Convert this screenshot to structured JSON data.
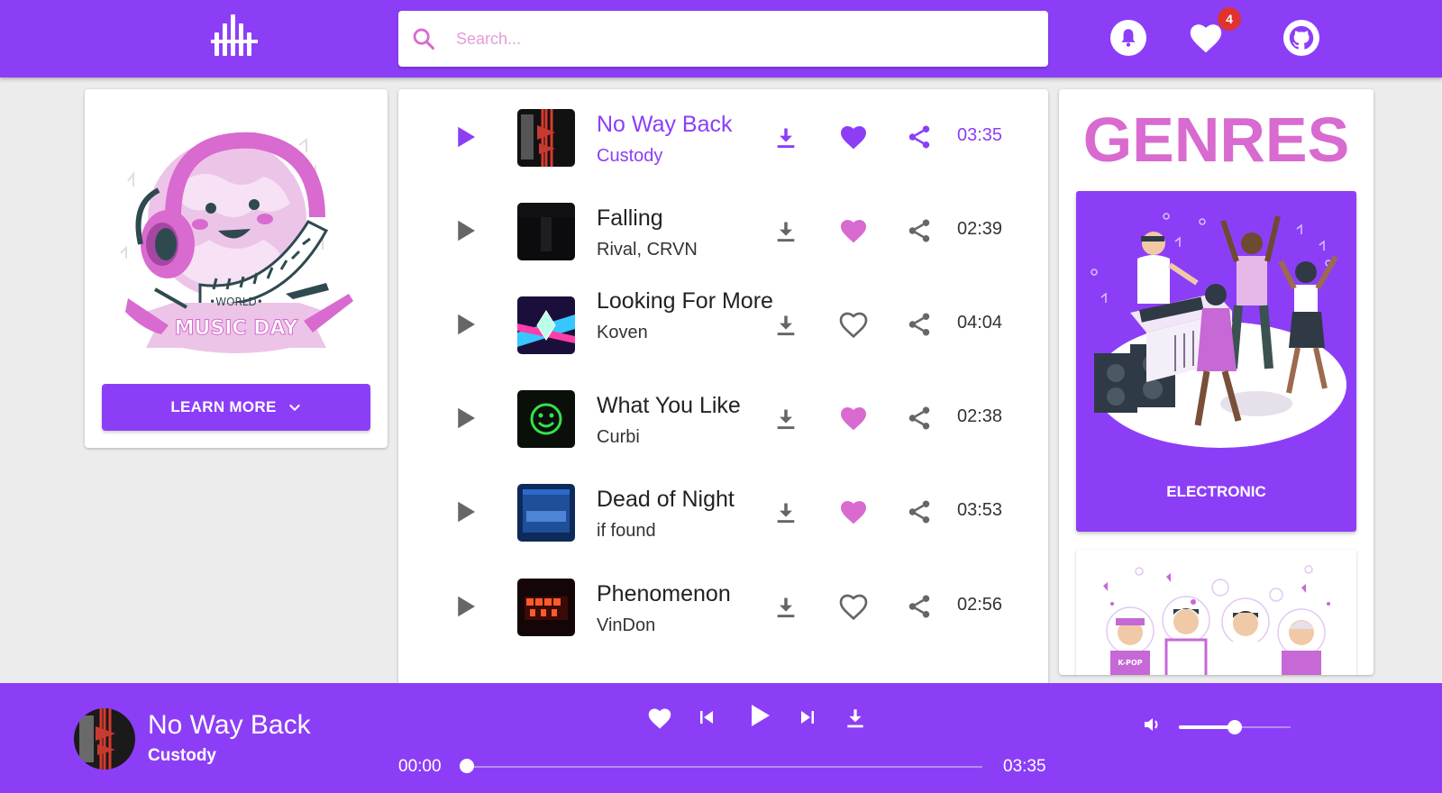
{
  "header": {
    "logo_icon": "equalizer-bars-icon",
    "search": {
      "placeholder": "Search...",
      "icon": "search-icon"
    },
    "notifications_icon": "bell-icon",
    "favorites": {
      "icon": "heart-icon",
      "count": "4"
    },
    "github_icon": "github-icon",
    "brand_color": "#8c3ef7"
  },
  "promo": {
    "illustration": "World Music Day illustration",
    "learn_more_label": "LEARN MORE",
    "learn_more_icon": "chevron-down-icon"
  },
  "tracks": [
    {
      "title": "No Way Back",
      "artist": "Custody",
      "duration": "03:35",
      "liked": true,
      "active": true
    },
    {
      "title": "Falling",
      "artist": "Rival, CRVN",
      "duration": "02:39",
      "liked": true,
      "active": false
    },
    {
      "title": "Looking For More",
      "artist": "Koven",
      "duration": "04:04",
      "liked": false,
      "active": false
    },
    {
      "title": "What You Like",
      "artist": "Curbi",
      "duration": "02:38",
      "liked": true,
      "active": false
    },
    {
      "title": "Dead of Night",
      "artist": "if found",
      "duration": "03:53",
      "liked": true,
      "active": false
    },
    {
      "title": "Phenomenon",
      "artist": "VinDon",
      "duration": "02:56",
      "liked": false,
      "active": false
    }
  ],
  "genres": {
    "title": "GENRES",
    "items": [
      {
        "label": "ELECTRONIC"
      },
      {
        "label": ""
      }
    ]
  },
  "player": {
    "title": "No Way Back",
    "artist": "Custody",
    "current_time": "00:00",
    "total_time": "03:35",
    "progress": 0,
    "volume": 0.5
  },
  "colors": {
    "accent": "#8c3ef7",
    "pink": "#d86ad0",
    "icon_grey": "#666666"
  }
}
